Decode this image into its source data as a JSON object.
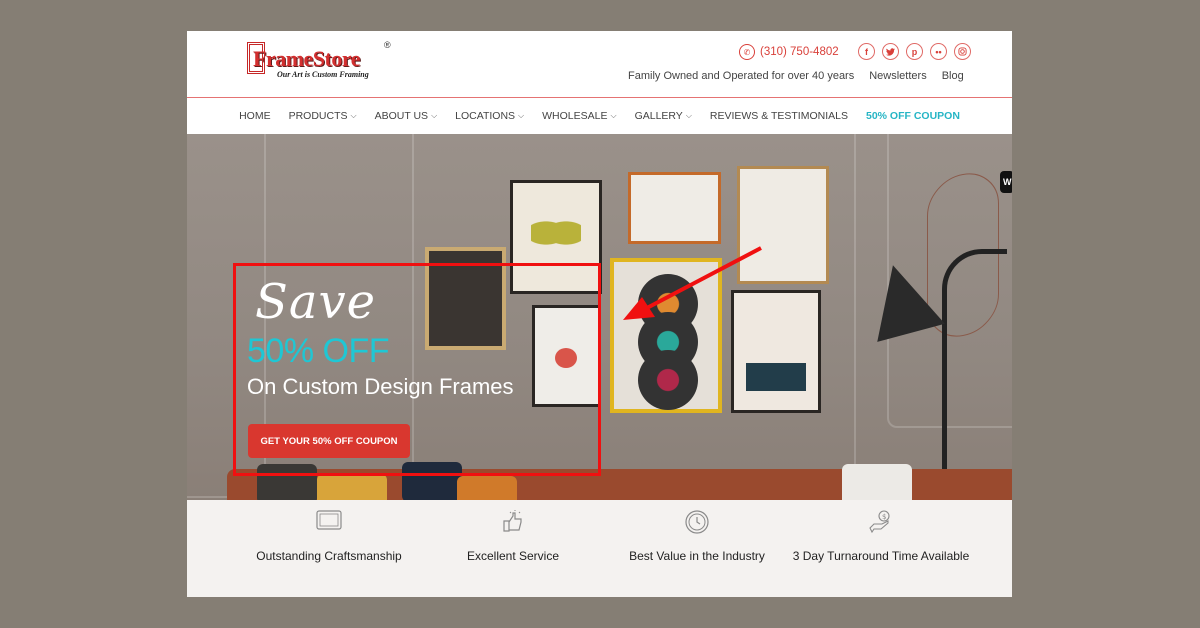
{
  "header": {
    "logo_text": "FrameStore",
    "logo_reg": "®",
    "logo_tagline": "Our Art is Custom Framing",
    "phone": "(310) 750-4802",
    "phone_icon": "phone-icon",
    "socials": [
      {
        "name": "facebook",
        "glyph": "f"
      },
      {
        "name": "twitter",
        "glyph": "t"
      },
      {
        "name": "pinterest",
        "glyph": "p"
      },
      {
        "name": "flickr",
        "glyph": "••"
      },
      {
        "name": "instagram",
        "glyph": "◎"
      }
    ],
    "subnav": [
      "Family Owned and Operated for over 40 years",
      "Newsletters",
      "Blog"
    ]
  },
  "nav": {
    "items": [
      {
        "label": "HOME",
        "dropdown": false
      },
      {
        "label": "PRODUCTS",
        "dropdown": true
      },
      {
        "label": "ABOUT US",
        "dropdown": true
      },
      {
        "label": "LOCATIONS",
        "dropdown": true
      },
      {
        "label": "WHOLESALE",
        "dropdown": true
      },
      {
        "label": "GALLERY",
        "dropdown": true
      },
      {
        "label": "REVIEWS & TESTIMONIALS",
        "dropdown": false
      },
      {
        "label": "50% OFF COUPON",
        "dropdown": false,
        "highlight": true
      }
    ],
    "chevron": "⌄"
  },
  "hero": {
    "save": "Save",
    "discount": "50% OFF",
    "subtitle": "On Custom Design Frames",
    "cta": "GET YOUR 50% OFF COUPON",
    "side_tab": "W"
  },
  "features": [
    {
      "icon": "frame-icon",
      "label": "Outstanding Craftsmanship"
    },
    {
      "icon": "thumbs-up-icon",
      "label": "Excellent Service"
    },
    {
      "icon": "clock-icon",
      "label": "Best Value in the Industry"
    },
    {
      "icon": "money-hand-icon",
      "label": "3 Day Turnaround Time Available"
    }
  ],
  "colors": {
    "brand_red": "#d9372f",
    "accent_cyan": "#1fc7d4",
    "annotation_red": "#f01010"
  }
}
